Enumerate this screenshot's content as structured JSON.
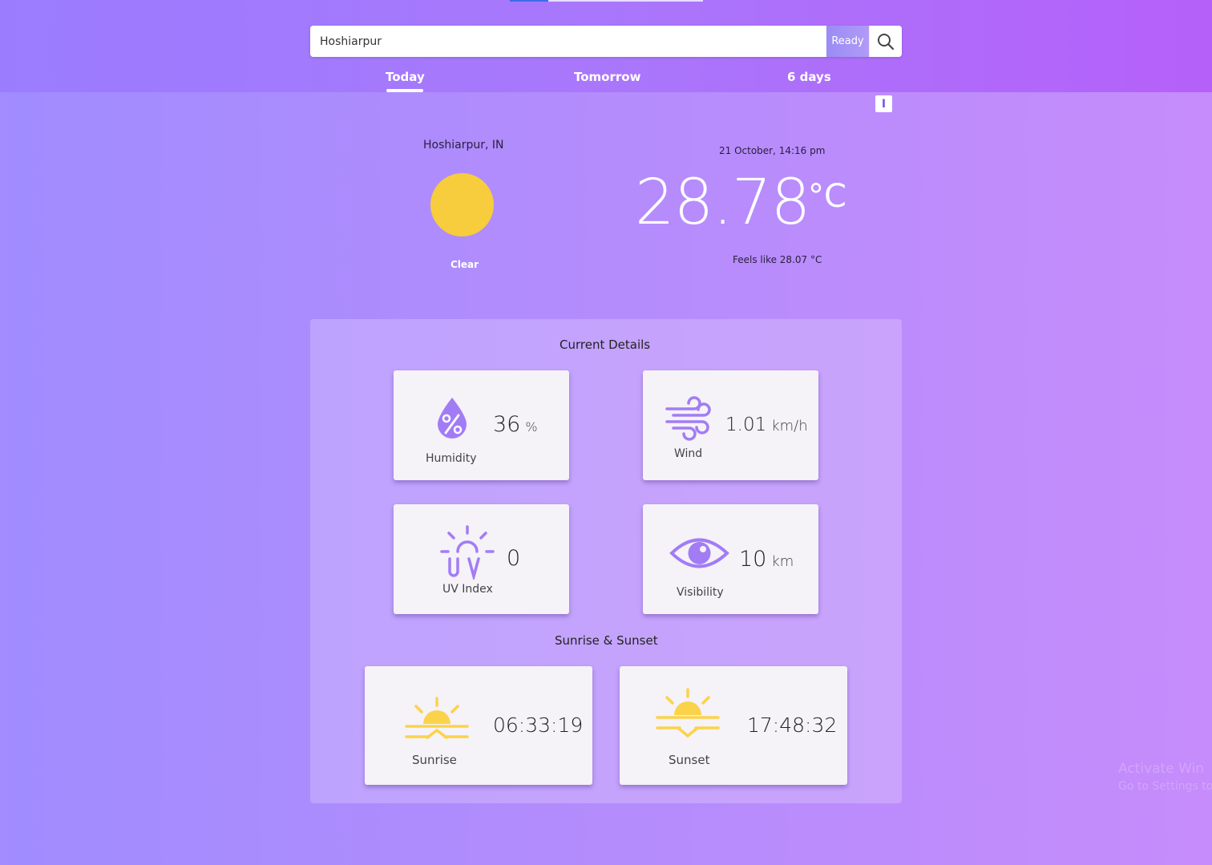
{
  "search": {
    "value": "Hoshiarpur",
    "status_label": "Ready"
  },
  "tabs": [
    {
      "label": "Today",
      "active": true
    },
    {
      "label": "Tomorrow",
      "active": false
    },
    {
      "label": "6 days",
      "active": false
    }
  ],
  "info_label": "I",
  "current": {
    "location": "Hoshiarpur, IN",
    "condition": "Clear",
    "condition_icon": "sun-icon",
    "datetime": "21 October, 14:16 pm",
    "temperature": "28.78",
    "temperature_unit": "°C",
    "feels_like": "Feels like 28.07 °C"
  },
  "details": {
    "title": "Current Details",
    "humidity": {
      "value": "36",
      "unit": "%",
      "label": "Humidity",
      "icon": "humidity-drop-icon"
    },
    "wind": {
      "value": "1.01",
      "unit": "km/h",
      "label": "Wind",
      "icon": "wind-icon"
    },
    "uv": {
      "value": "0",
      "label": "UV Index",
      "icon": "uv-index-icon"
    },
    "visibility": {
      "value": "10",
      "unit": "km",
      "label": "Visibility",
      "icon": "eye-icon"
    }
  },
  "sun": {
    "title": "Sunrise & Sunset",
    "sunrise": {
      "value": "06:33:19",
      "label": "Sunrise",
      "icon": "sunrise-icon"
    },
    "sunset": {
      "value": "17:48:32",
      "label": "Sunset",
      "icon": "sunset-icon"
    }
  },
  "watermark": {
    "line1": "Activate Win",
    "line2": "Go to Settings to"
  },
  "colors": {
    "accent": "#a27cf5",
    "sun": "#f7cc3d",
    "icon_yellow": "#fbd34a"
  }
}
